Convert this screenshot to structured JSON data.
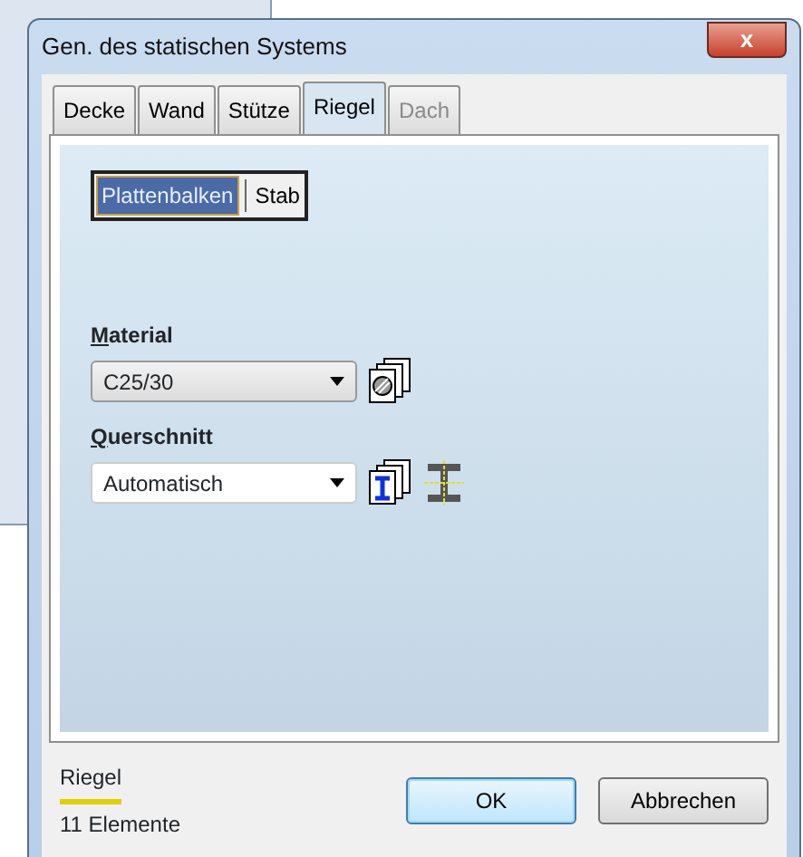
{
  "window": {
    "title": "Gen. des statischen Systems",
    "close_label": "x"
  },
  "tabs": [
    {
      "label": "Decke",
      "selected": false,
      "disabled": false
    },
    {
      "label": "Wand",
      "selected": false,
      "disabled": false
    },
    {
      "label": "Stütze",
      "selected": false,
      "disabled": false
    },
    {
      "label": "Riegel",
      "selected": true,
      "disabled": false
    },
    {
      "label": "Dach",
      "selected": false,
      "disabled": true
    }
  ],
  "mode_toggle": [
    {
      "label": "Plattenbalken",
      "selected": true
    },
    {
      "label": "Stab",
      "selected": false
    }
  ],
  "fields": [
    {
      "label": "Material",
      "underline_first": true,
      "value": "C25/30",
      "kind": "readonly",
      "icons": [
        {
          "kind": "library"
        }
      ]
    },
    {
      "label": "Querschnitt",
      "underline_first": true,
      "value": "Automatisch",
      "kind": "editable",
      "icons": [
        {
          "kind": "sectionlibrary"
        },
        {
          "kind": "beam"
        }
      ]
    }
  ],
  "footer": {
    "element_type": "Riegel",
    "count": "11 Elemente"
  },
  "buttons": [
    {
      "label": "OK",
      "default": true
    },
    {
      "label": "Abbrechen",
      "default": false
    }
  ]
}
